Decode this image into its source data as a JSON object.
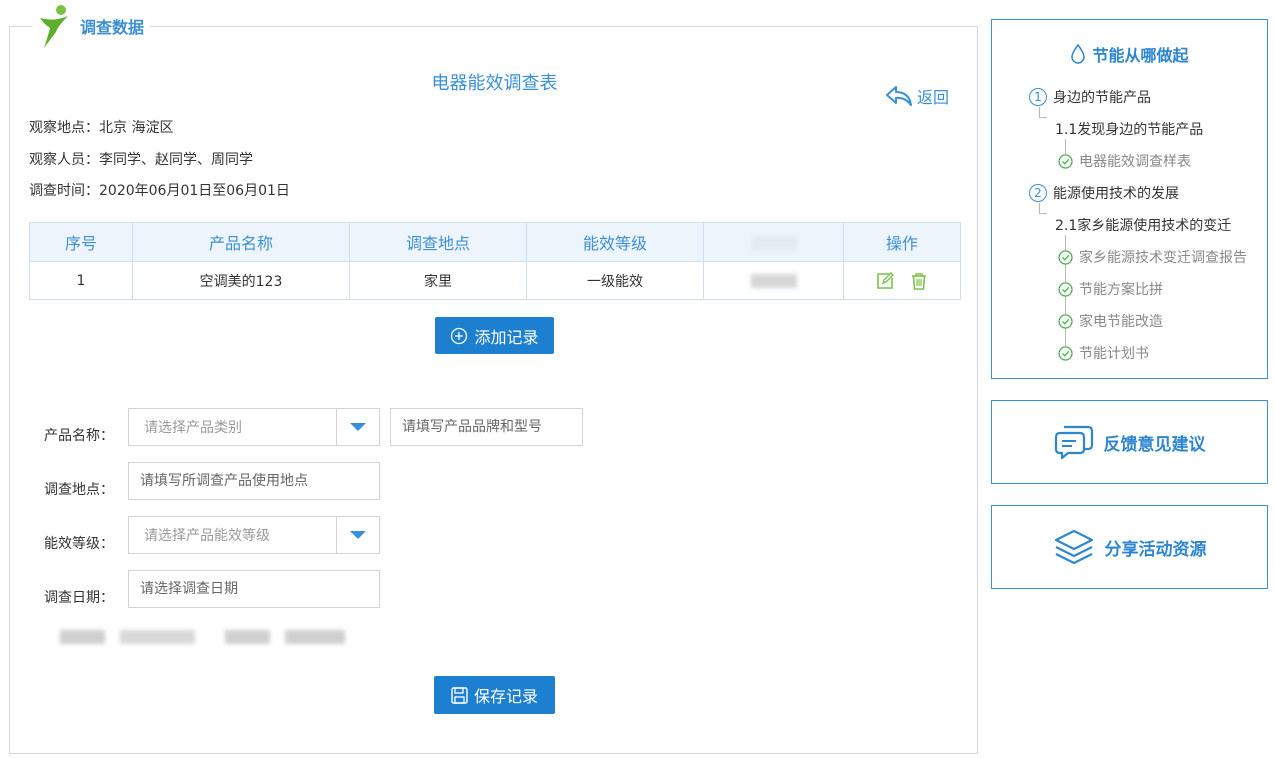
{
  "panel": {
    "title": "调查数据",
    "survey_title": "电器能效调查表",
    "back_label": "返回",
    "info": [
      "观察地点：北京 海淀区",
      "观察人员：李同学、赵同学、周同学",
      "调查时间：2020年06月01日至06月01日"
    ]
  },
  "table": {
    "headers": [
      "序号",
      "产品名称",
      "调查地点",
      "能效等级",
      "操作"
    ],
    "rows": [
      {
        "index": "1",
        "product": "空调美的123",
        "location": "家里",
        "level": "一级能效"
      }
    ]
  },
  "buttons": {
    "add_label": "添加记录",
    "save_label": "保存记录"
  },
  "form": {
    "product_label": "产品名称：",
    "product_category_placeholder": "请选择产品类别",
    "product_model_placeholder": "请填写产品品牌和型号",
    "location_label": "调查地点：",
    "location_placeholder": "请填写所调查产品使用地点",
    "level_label": "能效等级：",
    "level_placeholder": "请选择产品能效等级",
    "date_label": "调查日期：",
    "date_placeholder": "请选择调查日期"
  },
  "guide": {
    "title": "节能从哪做起",
    "sections": [
      {
        "num": "1",
        "label": "身边的节能产品"
      },
      {
        "num": "2",
        "label": "能源使用技术的发展"
      }
    ],
    "subs": [
      "1.1发现身边的节能产品",
      "2.1家乡能源使用技术的变迁"
    ],
    "leaves": [
      "电器能效调查样表",
      "家乡能源技术变迁调查报告",
      "节能方案比拼",
      "家电节能改造",
      "节能计划书"
    ]
  },
  "side_actions": {
    "feedback_label": "反馈意见建议",
    "share_label": "分享活动资源"
  },
  "colors": {
    "accent": "#3a8fd9",
    "button": "#1d7fd0",
    "table_header_bg": "#eef4fb",
    "check_green": "#4caf50"
  }
}
